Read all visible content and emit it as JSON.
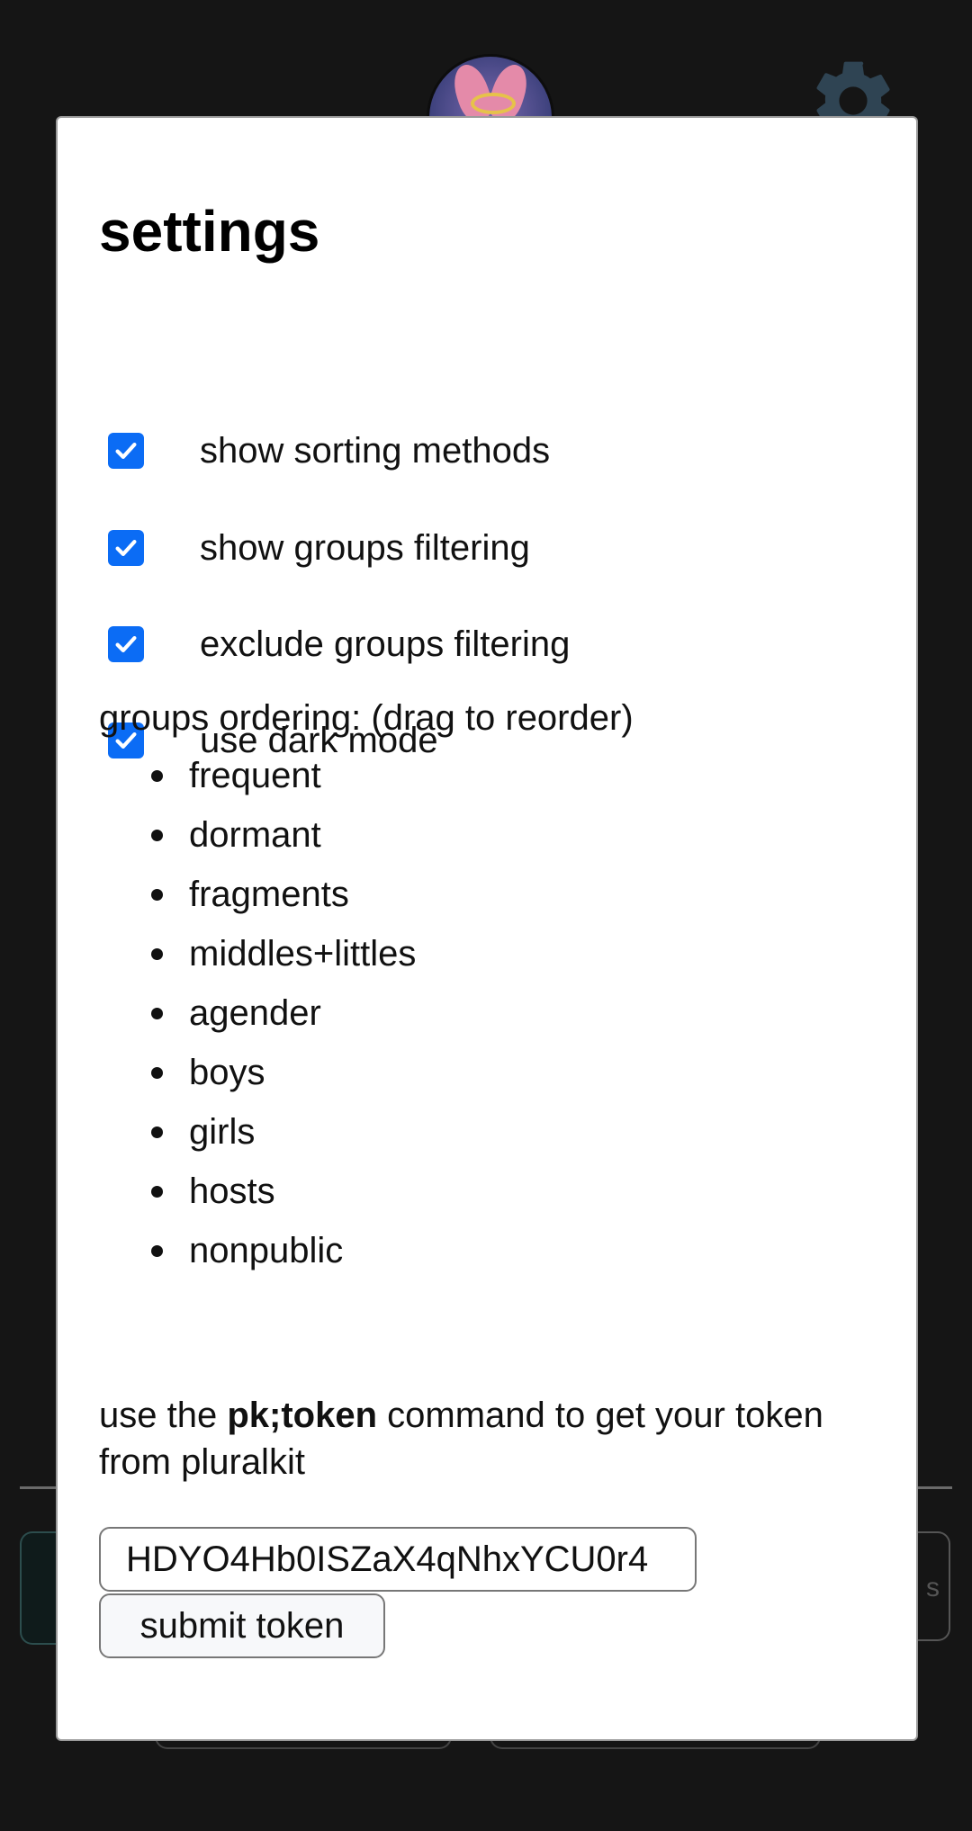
{
  "background": {
    "right_panel_fragment": "s"
  },
  "settings": {
    "title": "settings",
    "options": [
      {
        "label": "show sorting methods",
        "checked": true
      },
      {
        "label": "show groups filtering",
        "checked": true
      },
      {
        "label": "exclude groups filtering",
        "checked": true
      },
      {
        "label": "use dark mode",
        "checked": true
      }
    ],
    "groups_heading": "groups ordering: (drag to reorder)",
    "groups": [
      "frequent",
      "dormant",
      "fragments",
      "middles+littles",
      "agender",
      "boys",
      "girls",
      "hosts",
      "nonpublic"
    ],
    "token_help": {
      "prefix": "use the ",
      "command": "pk;token",
      "suffix": " command to get your token from pluralkit"
    },
    "token_value": "HDYO4Hb0ISZaX4qNhxYCU0r4",
    "submit_label": "submit token"
  },
  "colors": {
    "checkbox_accent": "#0b6cf5",
    "page_background": "#151515"
  }
}
